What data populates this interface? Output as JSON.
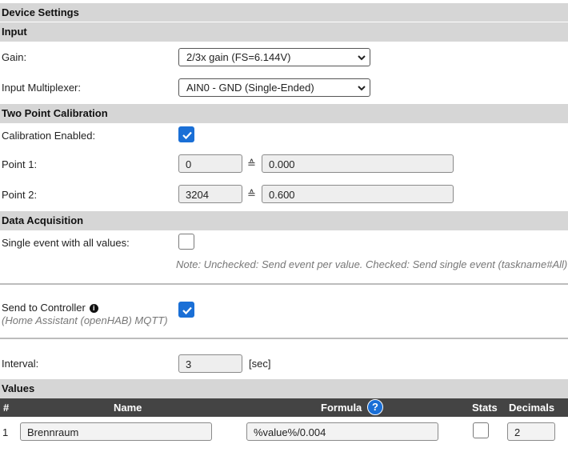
{
  "title": "Device Settings",
  "input": {
    "section": "Input",
    "gain_label": "Gain:",
    "gain_value": "2/3x gain (FS=6.144V)",
    "mux_label": "Input Multiplexer:",
    "mux_value": "AIN0 - GND (Single-Ended)"
  },
  "calibration": {
    "section": "Two Point Calibration",
    "enabled_label": "Calibration Enabled:",
    "enabled": true,
    "point1_label": "Point 1:",
    "point1_raw": "0",
    "point1_value": "0.000",
    "point2_label": "Point 2:",
    "point2_raw": "3204",
    "point2_value": "0.600",
    "approx_symbol": "≙"
  },
  "acquisition": {
    "section": "Data Acquisition",
    "single_event_label": "Single event with all values:",
    "single_event": false,
    "note": "Note: Unchecked: Send event per value. Checked: Send single event (taskname#All) c",
    "send_label": "Send to Controller",
    "send_info": "i",
    "send_sub": "(Home Assistant (openHAB) MQTT)",
    "send_enabled": true,
    "interval_label": "Interval:",
    "interval_value": "3",
    "interval_unit": "[sec]"
  },
  "values": {
    "section": "Values",
    "headers": {
      "index": "#",
      "name": "Name",
      "formula": "Formula",
      "help": "?",
      "stats": "Stats",
      "decimals": "Decimals"
    },
    "rows": [
      {
        "index": "1",
        "name": "Brennraum",
        "formula": "%value%/0.004",
        "stats": false,
        "decimals": "2"
      }
    ]
  },
  "colors": {
    "section_bg": "#d6d6d6",
    "header_bar": "#444444",
    "accent": "#1a6fd6"
  }
}
